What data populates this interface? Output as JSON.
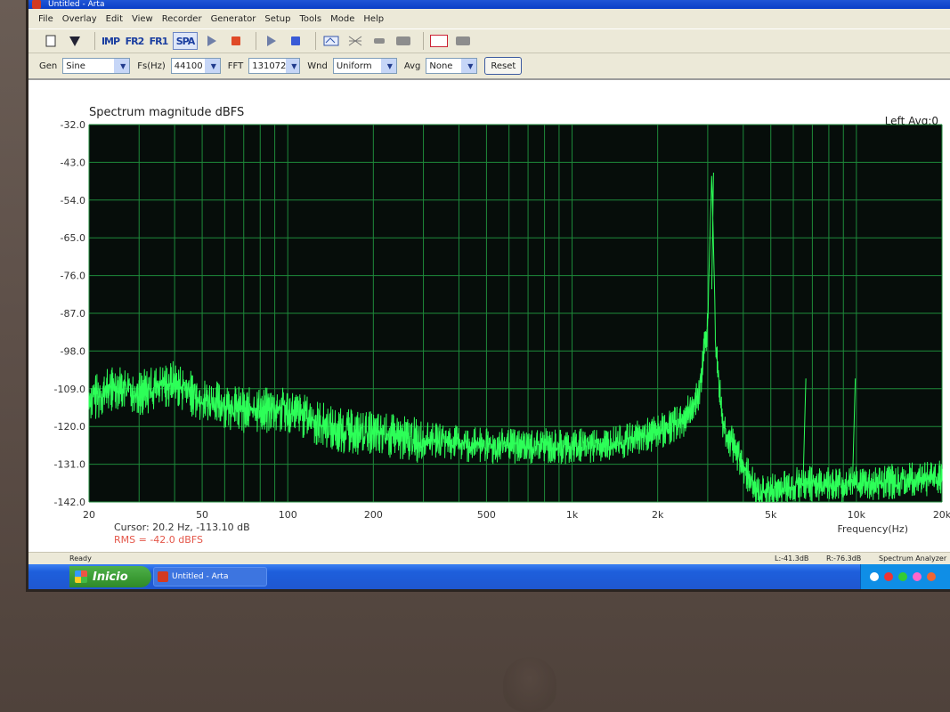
{
  "window": {
    "title": "Untitled - Arta"
  },
  "menu": [
    "File",
    "Overlay",
    "Edit",
    "View",
    "Recorder",
    "Generator",
    "Setup",
    "Tools",
    "Mode",
    "Help"
  ],
  "toolbar": {
    "imp": "IMP",
    "fr2": "FR2",
    "fr1": "FR1",
    "spa": "SPA"
  },
  "options": {
    "gen_label": "Gen",
    "gen_value": "Sine",
    "fs_label": "Fs(Hz)",
    "fs_value": "44100",
    "fft_label": "FFT",
    "fft_value": "131072",
    "wnd_label": "Wnd",
    "wnd_value": "Uniform",
    "avg_label": "Avg",
    "avg_value": "None",
    "reset_label": "Reset"
  },
  "plot": {
    "title": "Spectrum magnitude dBFS",
    "top_right": "Left  Avg:0",
    "cursor_text": "Cursor:  20.2 Hz, -113.10 dB",
    "rms_text": "RMS = -42.0 dBFS",
    "xlabel": "Frequency(Hz)"
  },
  "status": {
    "ready": "Ready",
    "left_level": "L:-41.3dB",
    "right_level": "R:-76.3dB",
    "mode": "Spectrum Analyzer"
  },
  "taskbar": {
    "start": "Inicio",
    "task": "Untitled - Arta"
  },
  "colors": {
    "plot_bg": "#060d0a",
    "trace": "#2dff58",
    "grid": "#1e8a3a"
  },
  "chart_data": {
    "type": "line",
    "title": "Spectrum magnitude dBFS",
    "xlabel": "Frequency(Hz)",
    "ylabel": "",
    "xscale": "log",
    "xlim": [
      20,
      20000
    ],
    "ylim": [
      -142,
      -32
    ],
    "yticks": [
      -32.0,
      -43.0,
      -54.0,
      -65.0,
      -76.0,
      -87.0,
      -98.0,
      -109.0,
      -120.0,
      -131.0,
      -142.0
    ],
    "ytick_labels": [
      "-32.0",
      "-43.0",
      "-54.0",
      "-65.0",
      "-76.0",
      "-87.0",
      "-98.0",
      "-109.0",
      "-120.0",
      "-131.0",
      "-142.0"
    ],
    "xticks": [
      20,
      50,
      100,
      200,
      500,
      1000,
      2000,
      5000,
      10000,
      20000
    ],
    "xtick_labels": [
      "20",
      "50",
      "100",
      "200",
      "500",
      "1k",
      "2k",
      "5k",
      "10k",
      "20k"
    ],
    "grid": true,
    "series": [
      {
        "x": [
          20,
          25,
          30,
          40,
          50,
          70,
          100,
          150,
          200,
          300,
          500,
          700,
          1000,
          1500,
          2000,
          2500,
          2800,
          3000,
          3100,
          3200,
          3400,
          3800,
          4500,
          5000,
          6000,
          8000,
          10000,
          15000,
          20000
        ],
        "y": [
          -110,
          -106,
          -108,
          -105,
          -110,
          -113,
          -113,
          -119,
          -120,
          -122,
          -124,
          -124,
          -124,
          -123,
          -120,
          -116,
          -108,
          -88,
          -46,
          -95,
          -118,
          -126,
          -138,
          -137,
          -135,
          -135,
          -135,
          -134,
          -133
        ]
      }
    ],
    "spurs": [
      {
        "x": 6500,
        "y": -106
      },
      {
        "x": 9700,
        "y": -106
      }
    ]
  }
}
